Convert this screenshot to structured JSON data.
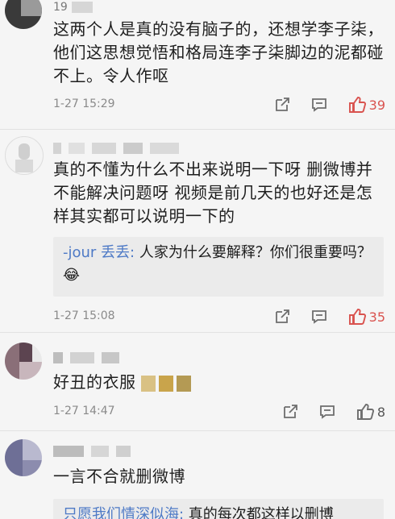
{
  "comments": [
    {
      "username": "19",
      "text": "这两个人是真的没有脑子的，还想学李子柒，他们这思想觉悟和格局连李子柒脚边的泥都碰不上。令人作呕",
      "time": "1-27 15:29",
      "likes": "39",
      "liked": true
    },
    {
      "username": "",
      "text": "真的不懂为什么不出来说明一下呀 删微博并不能解决问题呀 视频是前几天的也好还是怎样其实都可以说明一下的",
      "reply": {
        "name": "-jour 丢丢:",
        "text": " 人家为什么要解释？你们很重要吗？😂"
      },
      "time": "1-27 15:08",
      "likes": "35",
      "liked": true
    },
    {
      "username": "",
      "text": "好丑的衣服",
      "time": "1-27 14:47",
      "likes": "8",
      "liked": false
    },
    {
      "username": "",
      "text": "一言不合就删微博",
      "reply": {
        "name": "只愿我们情深似海:",
        "text": " 真的每次都这样以删博"
      }
    }
  ],
  "colors": {
    "liked": "#d9534f",
    "icon": "#6e6e6e",
    "reply_name": "#4e7ac6"
  },
  "icons": [
    "share-icon",
    "comment-icon",
    "thumbs-up-icon"
  ]
}
